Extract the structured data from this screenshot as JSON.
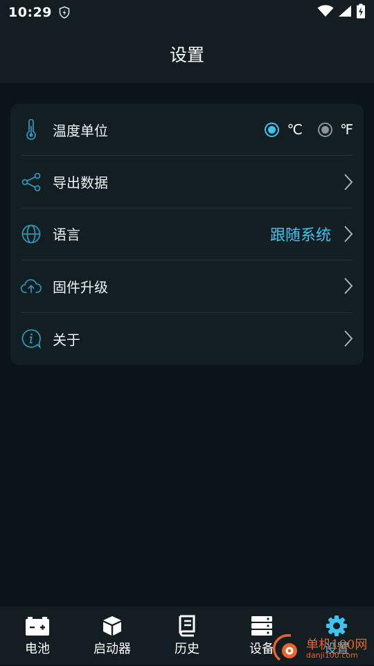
{
  "status_bar": {
    "time": "10:29"
  },
  "header": {
    "title": "设置"
  },
  "settings": {
    "temperature_unit": {
      "label": "温度单位",
      "options": [
        "℃",
        "℉"
      ],
      "selected": "℃"
    },
    "export_data": {
      "label": "导出数据"
    },
    "language": {
      "label": "语言",
      "value": "跟随系统"
    },
    "firmware": {
      "label": "固件升级"
    },
    "about": {
      "label": "关于"
    }
  },
  "bottom_nav": {
    "items": [
      {
        "label": "电池",
        "icon": "battery-icon"
      },
      {
        "label": "启动器",
        "icon": "box-icon"
      },
      {
        "label": "历史",
        "icon": "history-icon"
      },
      {
        "label": "设备",
        "icon": "server-icon"
      },
      {
        "label": "设置",
        "icon": "gear-icon",
        "active": true
      }
    ]
  },
  "watermark": {
    "line1": "单机100网",
    "line2": "danji100.com"
  },
  "colors": {
    "accent": "#3ec4f0",
    "icon_teal": "#2a97b5",
    "background": "#0a141a",
    "card": "#131e23"
  }
}
